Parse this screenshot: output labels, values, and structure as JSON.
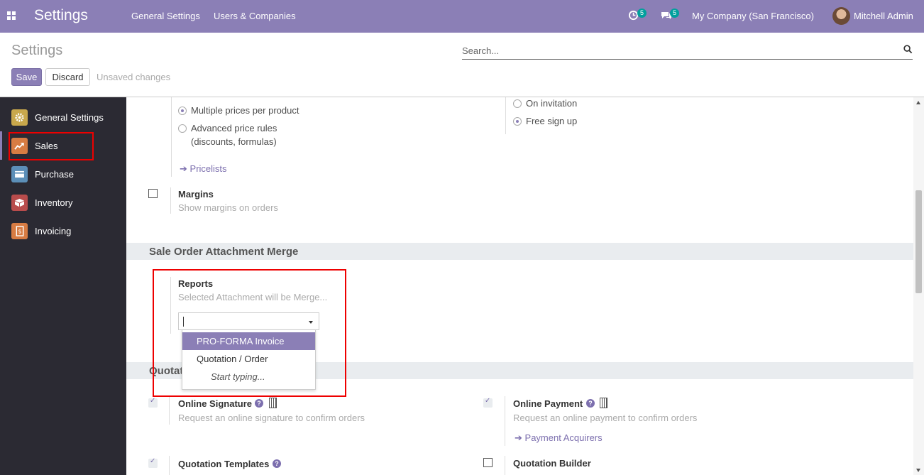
{
  "navbar": {
    "app_title": "Settings",
    "menu": [
      "General Settings",
      "Users & Companies"
    ],
    "activity_count": "5",
    "message_count": "5",
    "company": "My Company (San Francisco)",
    "user": "Mitchell Admin"
  },
  "control_panel": {
    "title": "Settings",
    "search_placeholder": "Search...",
    "save_label": "Save",
    "discard_label": "Discard",
    "unsaved_label": "Unsaved changes"
  },
  "sidebar": {
    "items": [
      {
        "label": "General Settings",
        "icon": "gear-icon",
        "color": "#c9a84c"
      },
      {
        "label": "Sales",
        "icon": "chart-line-icon",
        "color": "#d87c43"
      },
      {
        "label": "Purchase",
        "icon": "credit-card-icon",
        "color": "#5c8fb8"
      },
      {
        "label": "Inventory",
        "icon": "box-icon",
        "color": "#b94c4c"
      },
      {
        "label": "Invoicing",
        "icon": "invoice-icon",
        "color": "#d87c43"
      }
    ],
    "active": "Sales"
  },
  "pricing": {
    "option_multiple": "Multiple prices per product",
    "option_advanced_line1": "Advanced price rules",
    "option_advanced_line2": "(discounts, formulas)",
    "pricelists_link": "Pricelists"
  },
  "signup": {
    "option_invitation": "On invitation",
    "option_free": "Free sign up"
  },
  "margins": {
    "title": "Margins",
    "description": "Show margins on orders"
  },
  "attachment_merge": {
    "section_title": "Sale Order Attachment Merge",
    "reports_title": "Reports",
    "reports_description": "Selected Attachment will be Merge...",
    "dropdown_options": [
      "PRO-FORMA Invoice",
      "Quotation / Order"
    ],
    "dropdown_hint": "Start typing..."
  },
  "quotations": {
    "section_title_partial": "Quotat",
    "online_signature_title": "Online Signature",
    "online_signature_desc": "Request an online signature to confirm orders",
    "online_payment_title": "Online Payment",
    "online_payment_desc": "Request an online payment to confirm orders",
    "payment_acquirers_link": "Payment Acquirers",
    "quotation_templates_title": "Quotation Templates",
    "quotation_builder_title": "Quotation Builder"
  },
  "colors": {
    "brand": "#8b7fb6",
    "sidebar_bg": "#2b2a33",
    "highlight_box": "#e00000"
  }
}
